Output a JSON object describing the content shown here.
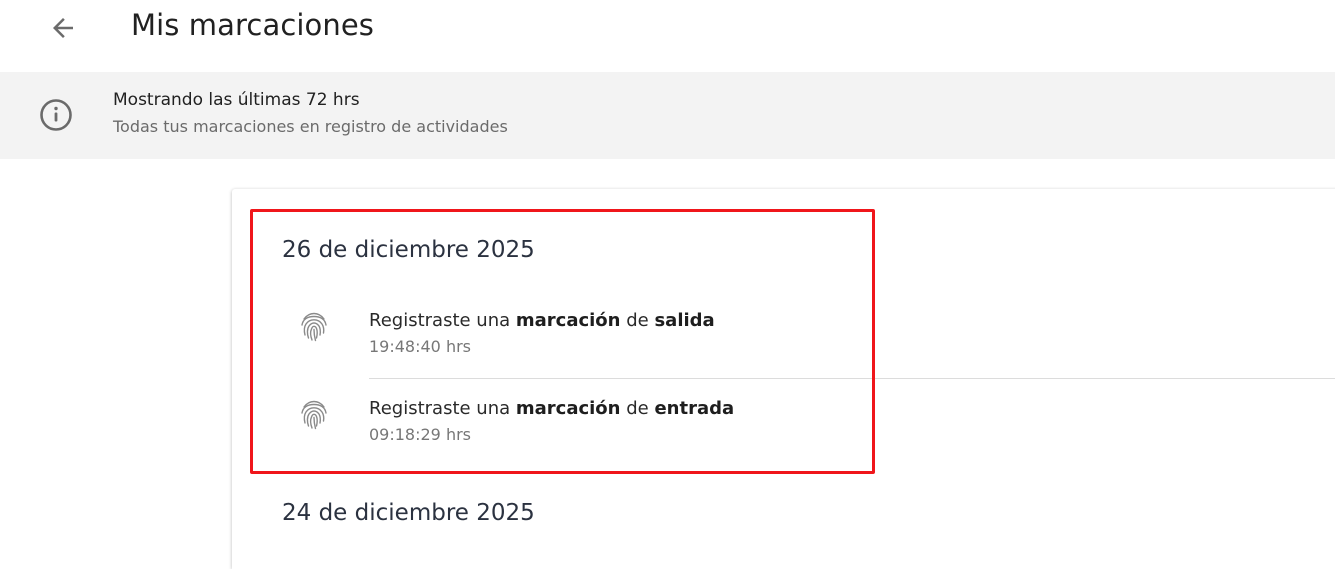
{
  "header": {
    "title": "Mis marcaciones",
    "back_icon": "arrow-left-icon"
  },
  "info": {
    "icon": "info-circle-icon",
    "title": "Mostrando las últimas 72 hrs",
    "subtitle": "Todas tus marcaciones en registro de actividades"
  },
  "days": [
    {
      "date": "26 de diciembre 2025",
      "records": [
        {
          "icon": "fingerprint-icon",
          "prefix": "Registraste una ",
          "emph1": "marcación",
          "middle": " de ",
          "emph2": "salida",
          "time": "19:48:40 hrs"
        },
        {
          "icon": "fingerprint-icon",
          "prefix": "Registraste una ",
          "emph1": "marcación",
          "middle": " de ",
          "emph2": "entrada",
          "time": "09:18:29 hrs"
        }
      ]
    },
    {
      "date": "24 de diciembre 2025",
      "records": []
    }
  ],
  "colors": {
    "highlight": "#f0161b",
    "info_bar": "#f3f3f3"
  }
}
